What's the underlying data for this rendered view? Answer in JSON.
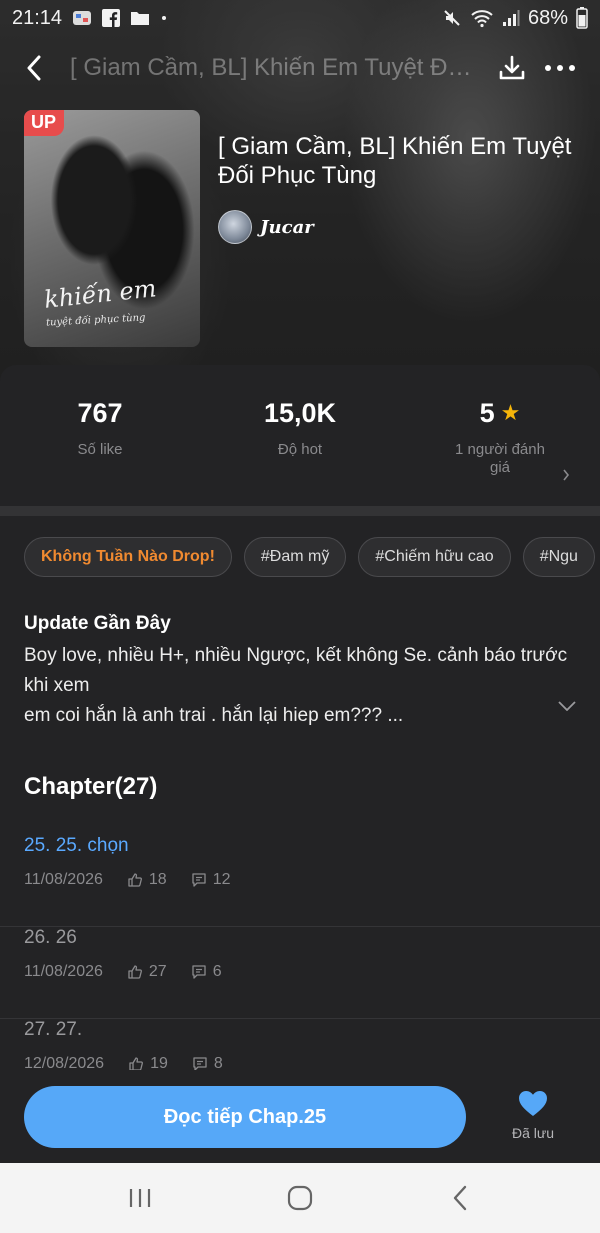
{
  "status_bar": {
    "time": "21:14",
    "battery": "68%"
  },
  "nav": {
    "title": "[ Giam Cầm, BL] Khiến Em Tuyệt Đối Phục Tùng"
  },
  "cover": {
    "badge": "UP",
    "script_title": "khiến em",
    "script_subtitle": "tuyệt đối phục tùng"
  },
  "book": {
    "title": "[ Giam Cầm, BL] Khiến Em Tuyệt Đối Phục Tùng",
    "author": "Jucar"
  },
  "stats": {
    "likes": {
      "value": "767",
      "label": "Số like"
    },
    "hot": {
      "value": "15,0K",
      "label": "Độ hot"
    },
    "rating": {
      "value": "5",
      "label": "1 người đánh giá"
    }
  },
  "tags": [
    "Không Tuần Nào Drop!",
    "#Đam mỹ",
    "#Chiếm hữu cao",
    "#Ngu"
  ],
  "description": {
    "title": "Update Gần Đây",
    "line1": "Boy love, nhiều H+, nhiều Ngược, kết không Se.  cảnh báo trước khi xem",
    "line2": "em coi hắn là anh trai . hắn lại hiep em??? ..."
  },
  "chapters": {
    "title": "Chapter(27)",
    "items": [
      {
        "name": "25. 25. chọn",
        "date": "11/08/2026",
        "likes": "18",
        "comments": "12"
      },
      {
        "name": "26. 26",
        "date": "11/08/2026",
        "likes": "27",
        "comments": "6"
      },
      {
        "name": "27. 27.",
        "date": "12/08/2026",
        "likes": "19",
        "comments": "8"
      }
    ]
  },
  "actions": {
    "read_label": "Đọc tiếp Chap.25",
    "saved_label": "Đã lưu"
  },
  "colors": {
    "accent_blue": "#56a8f8",
    "active_chapter": "#5aa9ff",
    "tag_highlight": "#f08a30",
    "badge_red": "#e74c4c",
    "star": "#f5b50a"
  }
}
